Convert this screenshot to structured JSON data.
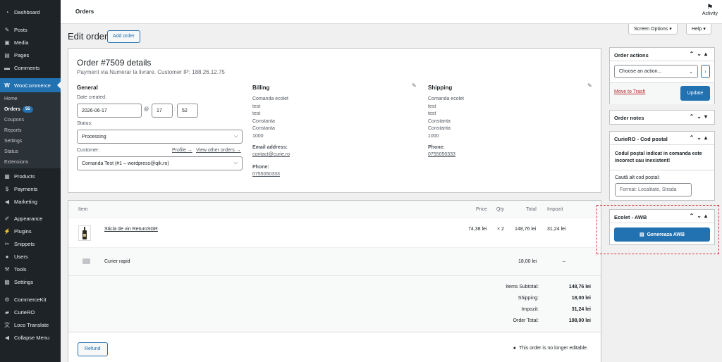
{
  "sidebar": {
    "items": [
      {
        "label": "Dashboard",
        "icon": "dashboard-icon"
      },
      {
        "label": "Posts",
        "icon": "pin-icon"
      },
      {
        "label": "Media",
        "icon": "media-icon"
      },
      {
        "label": "Pages",
        "icon": "pages-icon"
      },
      {
        "label": "Comments",
        "icon": "comments-icon"
      },
      {
        "label": "WooCommerce",
        "icon": "woocommerce-icon"
      },
      {
        "label": "Products",
        "icon": "products-icon"
      },
      {
        "label": "Payments",
        "icon": "payments-icon"
      },
      {
        "label": "Marketing",
        "icon": "megaphone-icon"
      },
      {
        "label": "Appearance",
        "icon": "brush-icon"
      },
      {
        "label": "Plugins",
        "icon": "plugins-icon"
      },
      {
        "label": "Snippets",
        "icon": "scissors-icon"
      },
      {
        "label": "Users",
        "icon": "users-icon"
      },
      {
        "label": "Tools",
        "icon": "wrench-icon"
      },
      {
        "label": "Settings",
        "icon": "settings-icon"
      },
      {
        "label": "CommerceKit",
        "icon": "gear-icon"
      },
      {
        "label": "CurieRO",
        "icon": "truck-icon"
      },
      {
        "label": "Loco Translate",
        "icon": "translate-icon"
      },
      {
        "label": "Collapse Menu",
        "icon": "collapse-icon"
      }
    ],
    "woo_sub": [
      {
        "label": "Home"
      },
      {
        "label": "Orders",
        "badge": "55"
      },
      {
        "label": "Coupons"
      },
      {
        "label": "Reports"
      },
      {
        "label": "Settings"
      },
      {
        "label": "Status"
      },
      {
        "label": "Extensions"
      }
    ]
  },
  "topbar": {
    "title": "Orders",
    "activity": "Activity"
  },
  "screen_options": "Screen Options ▾",
  "help": "Help ▾",
  "heading": "Edit order",
  "add_order": "Add order",
  "order": {
    "title": "Order #7509 details",
    "subtitle": "Payment via Numerar la livrare. Customer IP: 188.26.12.75",
    "general": {
      "heading": "General",
      "date_label": "Date created:",
      "date": "2026-06-17",
      "at": "@",
      "hour": "17",
      "colon": ":",
      "minute": "52",
      "status_label": "Status:",
      "status": "Processing",
      "customer_label": "Customer:",
      "profile_link": "Profile →",
      "other_orders_link": "View other orders →",
      "customer": "Comanda Test (#1 – wordpress@qik.ro)"
    },
    "billing": {
      "heading": "Billing",
      "lines": [
        "Comanda ecolet",
        "test",
        "test",
        "Constanta",
        "Constanta",
        "1000"
      ],
      "email_label": "Email address:",
      "email": "contact@curie.ro",
      "phone_label": "Phone:",
      "phone": "0755050333"
    },
    "shipping": {
      "heading": "Shipping",
      "lines": [
        "Comanda ecolet",
        "test",
        "test",
        "Constanta",
        "Constanta",
        "1000"
      ],
      "phone_label": "Phone:",
      "phone": "0755050333"
    }
  },
  "items": {
    "headers": {
      "item": "Item",
      "price": "Price",
      "qty": "Qty",
      "total": "Total",
      "tax": "Impozit"
    },
    "product": {
      "name": "Sticla de vin ReturoSGR",
      "price": "74,38 lei",
      "qty": "× 2",
      "total": "148,76 lei",
      "tax": "31,24 lei"
    },
    "shipping_line": {
      "name": "Curier rapid",
      "total": "18,00 lei",
      "tax": "–"
    },
    "totals": [
      {
        "label": "Items Subtotal:",
        "value": "148,76 lei"
      },
      {
        "label": "Shipping:",
        "value": "18,00 lei"
      },
      {
        "label": "Impozit:",
        "value": "31,24 lei"
      },
      {
        "label": "Order Total:",
        "value": "198,00 lei"
      }
    ],
    "refund": "Refund",
    "not_editable": "This order is no longer editable."
  },
  "order_actions": {
    "heading": "Order actions",
    "select": "Choose an action...",
    "trash": "Move to Trash",
    "update": "Update"
  },
  "order_notes": {
    "heading": "Order notes"
  },
  "curiero_postal": {
    "heading": "CurieRO - Cod postal",
    "warning": "Codul poștal indicat in comanda este incorect sau inexistent!",
    "search_label": "Caută alt cod poștal:",
    "search_placeholder": "Format: Localitate, Strada"
  },
  "ecolet": {
    "heading": "Ecolet - AWB",
    "button": "Genereaza AWB"
  },
  "colors": {
    "accent": "#2271b1",
    "sidebar": "#1d2327",
    "highlight": "#d63638"
  }
}
